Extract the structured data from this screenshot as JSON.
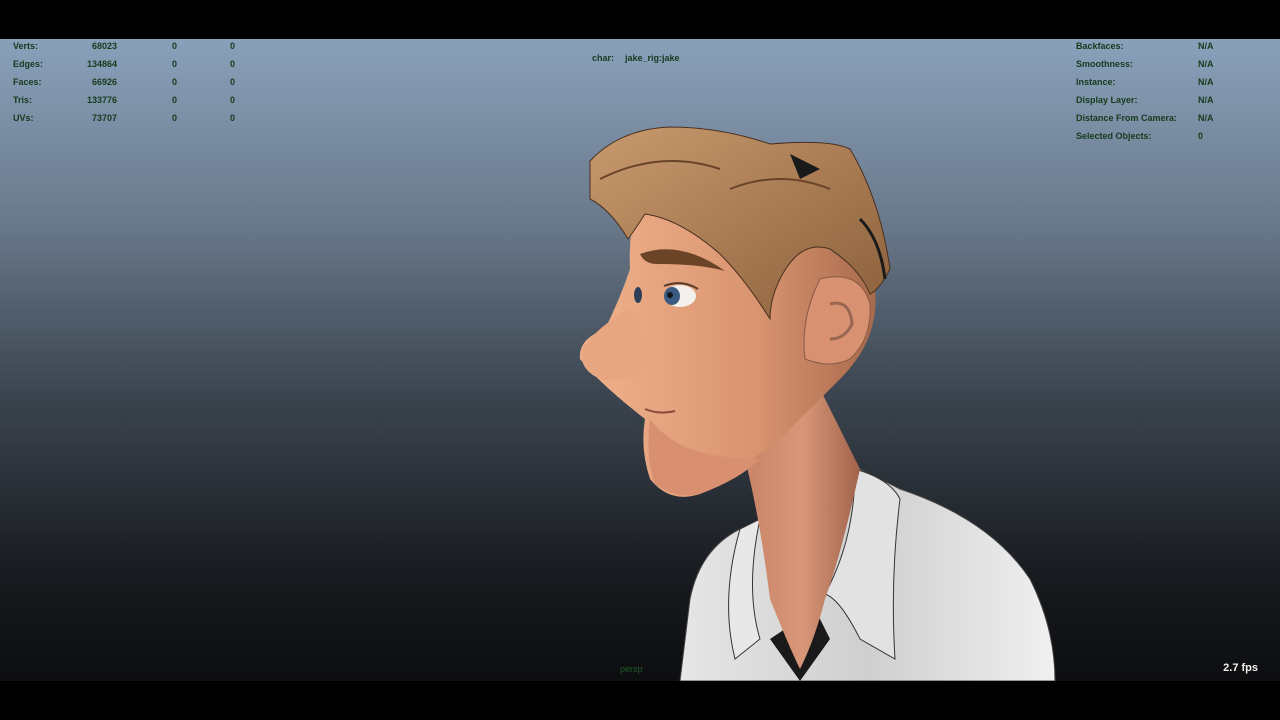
{
  "viewport": {
    "camera": "persp",
    "fps": "2.7 fps"
  },
  "stats": [
    {
      "label": "Verts:",
      "v1": "68023",
      "v2": "0",
      "v3": "0"
    },
    {
      "label": "Edges:",
      "v1": "134864",
      "v2": "0",
      "v3": "0"
    },
    {
      "label": "Faces:",
      "v1": "66926",
      "v2": "0",
      "v3": "0"
    },
    {
      "label": "Tris:",
      "v1": "133776",
      "v2": "0",
      "v3": "0"
    },
    {
      "label": "UVs:",
      "v1": "73707",
      "v2": "0",
      "v3": "0"
    }
  ],
  "selection": {
    "label": "char:",
    "value": "jake_rig:jake"
  },
  "info": [
    {
      "label": "Backfaces:",
      "value": "N/A"
    },
    {
      "label": "Smoothness:",
      "value": "N/A"
    },
    {
      "label": "Instance:",
      "value": "N/A"
    },
    {
      "label": "Display Layer:",
      "value": "N/A"
    },
    {
      "label": "Distance From Camera:",
      "value": "N/A"
    },
    {
      "label": "Selected Objects:",
      "value": "0"
    }
  ],
  "colors": {
    "hud_text": "#163a1c",
    "fps_text": "#f2f2f2",
    "skin": "#e0a07c",
    "hair": "#b8845a",
    "shirt": "#d8d8d8"
  }
}
